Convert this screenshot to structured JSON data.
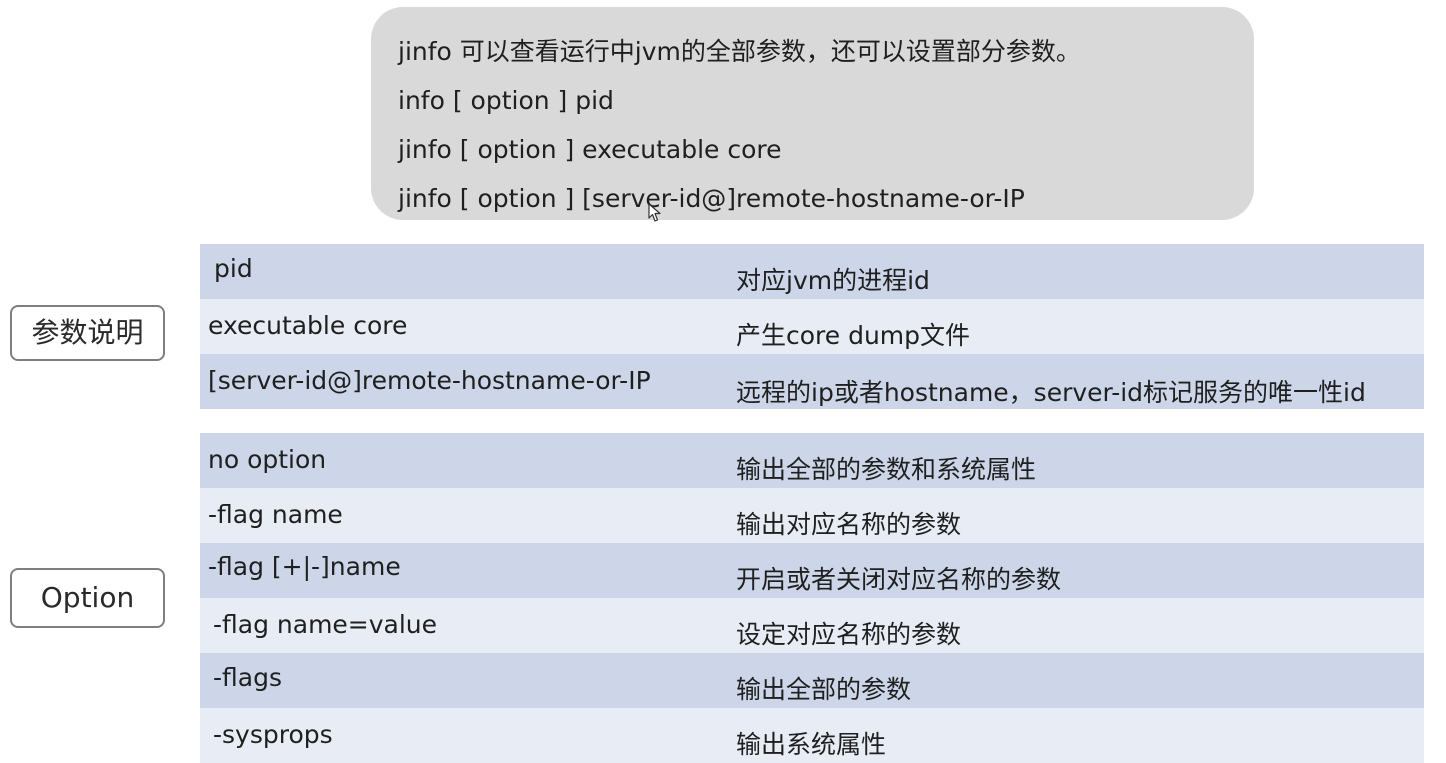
{
  "intro": {
    "lines": [
      "jinfo 可以查看运行中jvm的全部参数，还可以设置部分参数。",
      "info [ option ] pid",
      "jinfo [ option ] executable core",
      "jinfo [ option ] [server-id@]remote-hostname-or-IP"
    ]
  },
  "labels": {
    "params": "参数说明",
    "option": "Option"
  },
  "params_table": {
    "rows": [
      {
        "name": "pid",
        "desc": "对应jvm的进程id"
      },
      {
        "name": "executable core",
        "desc": "产生core dump文件"
      },
      {
        "name": "[server-id@]remote-hostname-or-IP",
        "desc": "远程的ip或者hostname，server-id标记服务的唯一性id"
      }
    ]
  },
  "option_table": {
    "rows": [
      {
        "name": "no option",
        "desc": "输出全部的参数和系统属性"
      },
      {
        "name": "-flag  name",
        "desc": "输出对应名称的参数"
      },
      {
        "name": "-flag [+|-]name",
        "desc": "开启或者关闭对应名称的参数"
      },
      {
        "name": "-flag name=value",
        "desc": "设定对应名称的参数"
      },
      {
        "name": "-flags",
        "desc": "输出全部的参数"
      },
      {
        "name": "-sysprops",
        "desc": "输出系统属性"
      }
    ]
  },
  "colors": {
    "intro_bg": "#d9d9d9",
    "row_dark": "#ccd6e8",
    "row_light": "#e8ecf5",
    "label_border": "#7f7f7f"
  }
}
